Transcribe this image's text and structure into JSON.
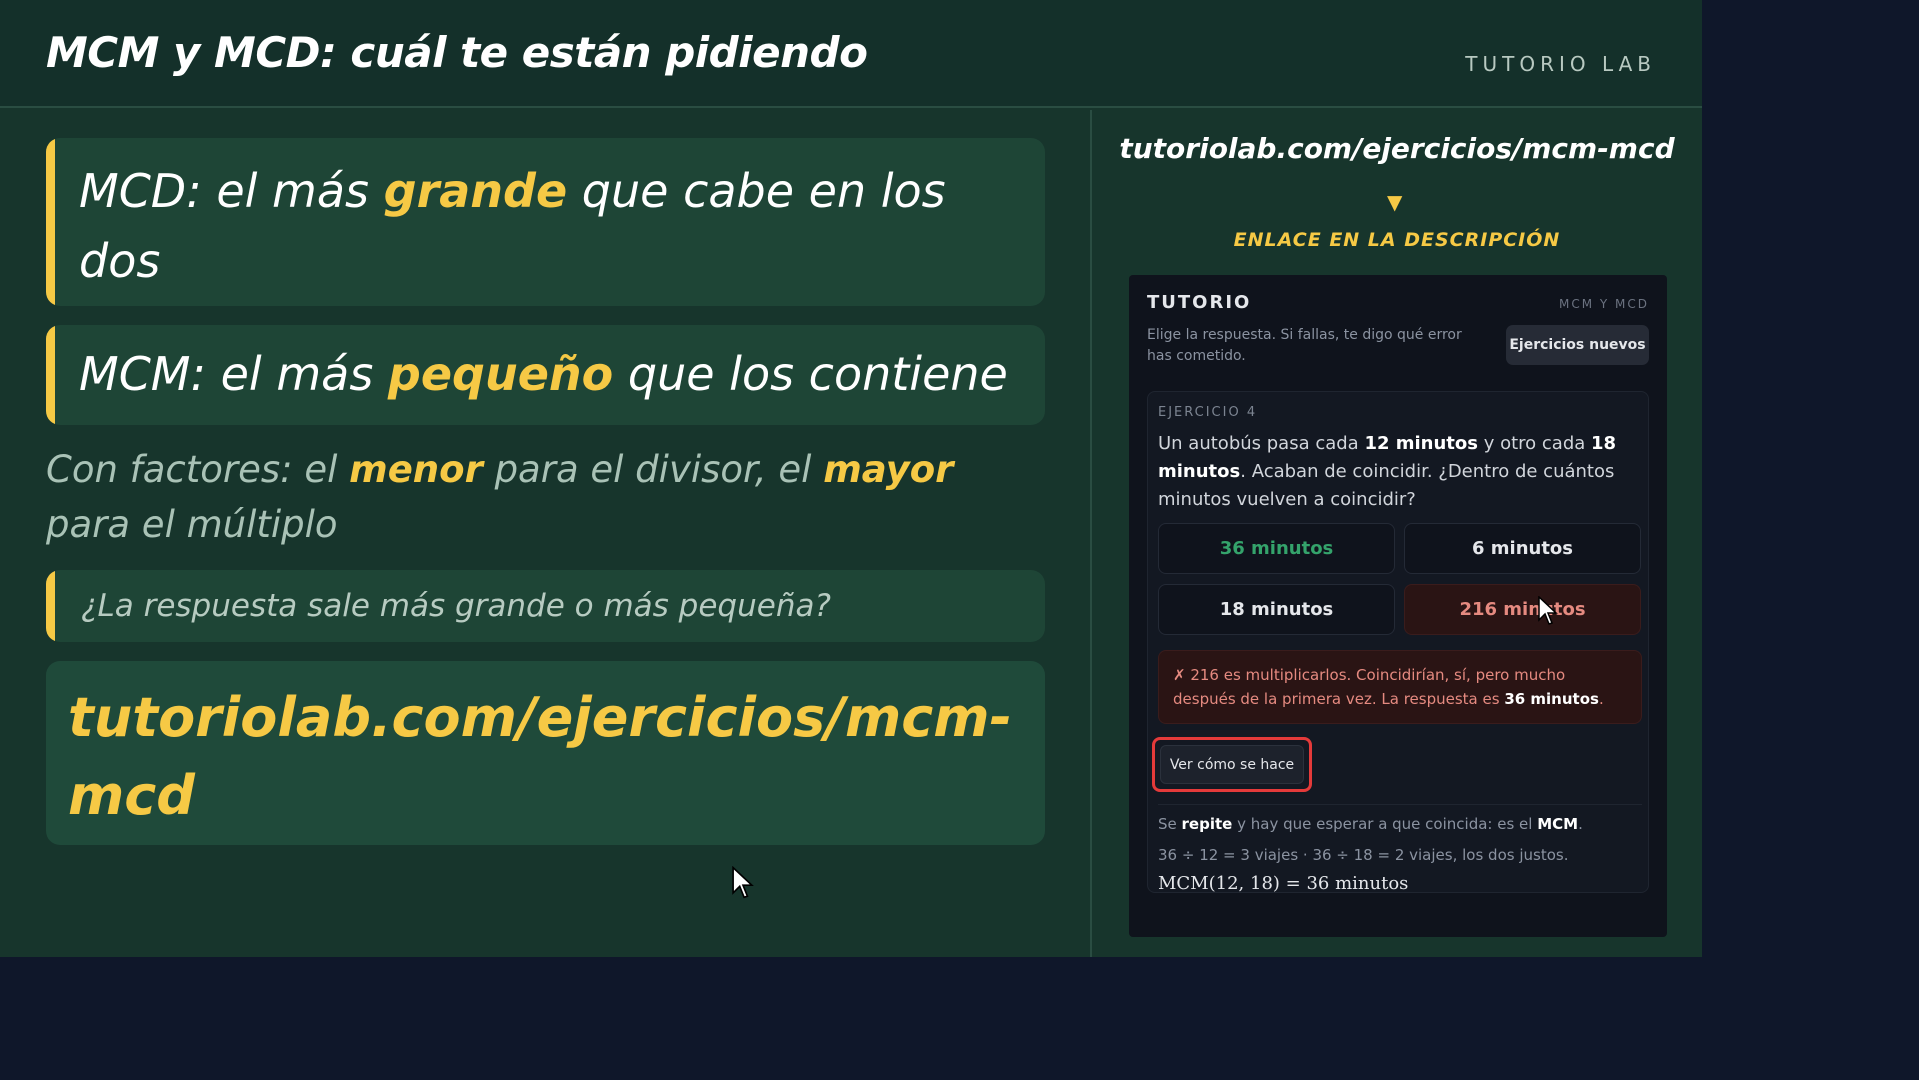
{
  "header": {
    "title": "MCM y MCD: cuál te están pidiendo",
    "brand": "TUTORIO LAB"
  },
  "slide": {
    "mcd_card": {
      "prefix": "MCD: el más ",
      "highlight": "grande",
      "suffix": " que cabe en los dos"
    },
    "mcm_card": {
      "prefix": "MCM: el más ",
      "highlight": "pequeño",
      "suffix": " que los contiene"
    },
    "factors_note": {
      "part1": "Con factores: el ",
      "hl1": "menor",
      "part2": " para el divisor, el ",
      "hl2": "mayor",
      "part3": " para el múltiplo"
    },
    "question_card": "¿La respuesta sale más grande o más pequeña?",
    "url_card": "tutoriolab.com/ejercicios/mcm-mcd"
  },
  "side": {
    "url": "tutoriolab.com/ejercicios/mcm-mcd",
    "arrow": "▼",
    "link_note": "ENLACE EN LA DESCRIPCIÓN"
  },
  "app": {
    "title": "TUTORIO",
    "tag": "MCM Y MCD",
    "subtitle": "Elige la respuesta. Si fallas, te digo qué error has cometido.",
    "new_exercises_button": "Ejercicios nuevos",
    "exercise": {
      "label": "EJERCICIO 4",
      "q_part1": "Un autobús pasa cada ",
      "q_bold1": "12 minutos",
      "q_part2": " y otro cada ",
      "q_bold2": "18 minutos",
      "q_part3": ". Acaban de coincidir. ¿Dentro de cuántos minutos vuelven a coincidir?",
      "options": [
        {
          "label": "36 minutos",
          "state": "correct"
        },
        {
          "label": "6 minutos",
          "state": "neutral"
        },
        {
          "label": "18 minutos",
          "state": "neutral"
        },
        {
          "label": "216 minutos",
          "state": "wrong"
        }
      ],
      "feedback": {
        "mark": "✗",
        "text": " 216 es multiplicarlos. Coincidirían, sí, pero mucho después de la primera vez. La respuesta es ",
        "answer": "36 minutos",
        "end": "."
      },
      "how_button": "Ver cómo se hace",
      "explanation": {
        "l1_a": "Se ",
        "l1_b1": "repite",
        "l1_c": " y hay que esperar a que coincida: es el ",
        "l1_b2": "MCM",
        "l1_d": ".",
        "l2": "36 ÷ 12 = 3 viajes  ·  36 ÷ 18 = 2 viajes, los dos justos.",
        "l3": "MCM(12, 18) = 36 minutos"
      }
    }
  },
  "colors": {
    "accent": "#f6c945",
    "stage_bg": "#17352c",
    "card_bg": "#1e4536",
    "app_bg": "#0f131c",
    "correct": "#34a36b",
    "wrong": "#e58a80",
    "focus_ring": "#e43a3a"
  }
}
